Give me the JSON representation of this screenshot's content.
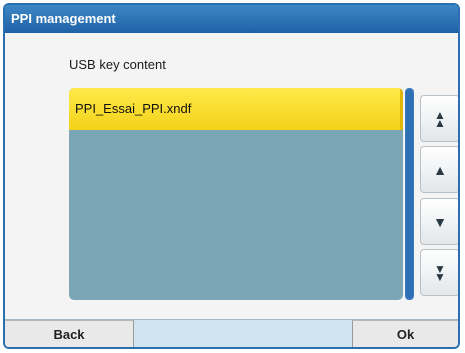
{
  "window": {
    "title": "PPI management"
  },
  "content": {
    "section_label": "USB key content",
    "files": [
      {
        "name": "PPI_Essai_PPI.xndf",
        "selected": true
      }
    ]
  },
  "scroll_buttons": {
    "top_icon": "double-arrow-up-icon",
    "up_icon": "arrow-up-icon",
    "down_icon": "arrow-down-icon",
    "bottom_icon": "double-arrow-down-icon"
  },
  "footer": {
    "back_label": "Back",
    "ok_label": "Ok"
  },
  "colors": {
    "title_bar": "#1f63a6",
    "list_background": "#7aa6b5",
    "selected_item": "#f3d21a",
    "footer": "#cfe5ef"
  }
}
